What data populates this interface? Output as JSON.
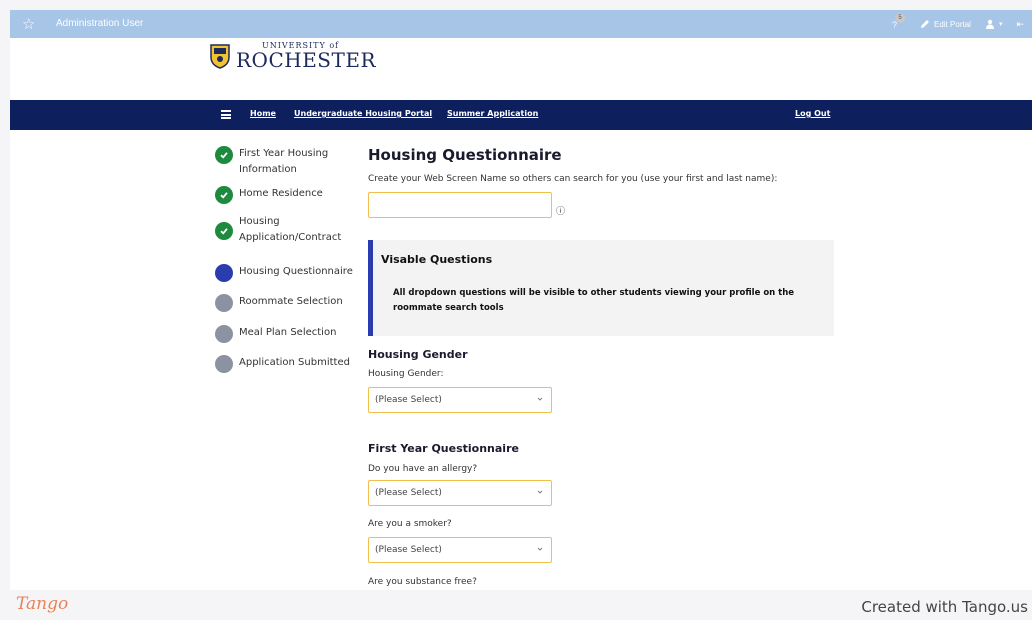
{
  "admin_bar": {
    "user_name": "Administration User",
    "notification_count": "5",
    "help_label": "?",
    "edit_portal_label": "Edit Portal"
  },
  "logo": {
    "university_of": "UNIVERSITY of",
    "name": "ROCHESTER"
  },
  "nav": {
    "items": [
      {
        "label": "Home"
      },
      {
        "label": "Undergraduate Housing Portal"
      },
      {
        "label": "Summer Application"
      }
    ],
    "logout_label": "Log Out"
  },
  "steps": [
    {
      "line1": "First Year Housing",
      "line2": "Information",
      "status": "done"
    },
    {
      "line1": "Home Residence",
      "line2": "",
      "status": "done"
    },
    {
      "line1": "Housing",
      "line2": "Application/Contract",
      "status": "done"
    },
    {
      "line1": "Housing Questionnaire",
      "line2": "",
      "status": "current"
    },
    {
      "line1": "Roommate Selection",
      "line2": "",
      "status": "todo"
    },
    {
      "line1": "Meal Plan Selection",
      "line2": "",
      "status": "todo"
    },
    {
      "line1": "Application Submitted",
      "line2": "",
      "status": "todo"
    }
  ],
  "main": {
    "title": "Housing Questionnaire",
    "web_name_prompt": "Create your Web Screen Name so others can search for you (use your first and last name):",
    "web_name_value": "",
    "info_glyph": "ⓘ",
    "callout_title": "Visable Questions",
    "callout_body": "All dropdown questions will be visible to other students viewing your profile on the roommate search tools",
    "gender_heading": "Housing Gender",
    "gender_label": "Housing Gender:",
    "gender_value": "(Please Select)",
    "fy_heading": "First Year Questionnaire",
    "allergy_label": "Do you have an allergy?",
    "allergy_value": "(Please Select)",
    "smoker_label": "Are you a smoker?",
    "smoker_value": "(Please Select)",
    "substance_label": "Are you substance free?"
  },
  "footer": {
    "brand": "Tango",
    "credit": "Created with Tango.us"
  },
  "colors": {
    "admin_bar": "#a7c5e6",
    "navbar": "#0d1f5c",
    "done": "#1e8a3e",
    "current": "#2a3cae",
    "todo": "#8c92a1",
    "input_border": "#f0c04a",
    "tango": "#e8835a"
  }
}
